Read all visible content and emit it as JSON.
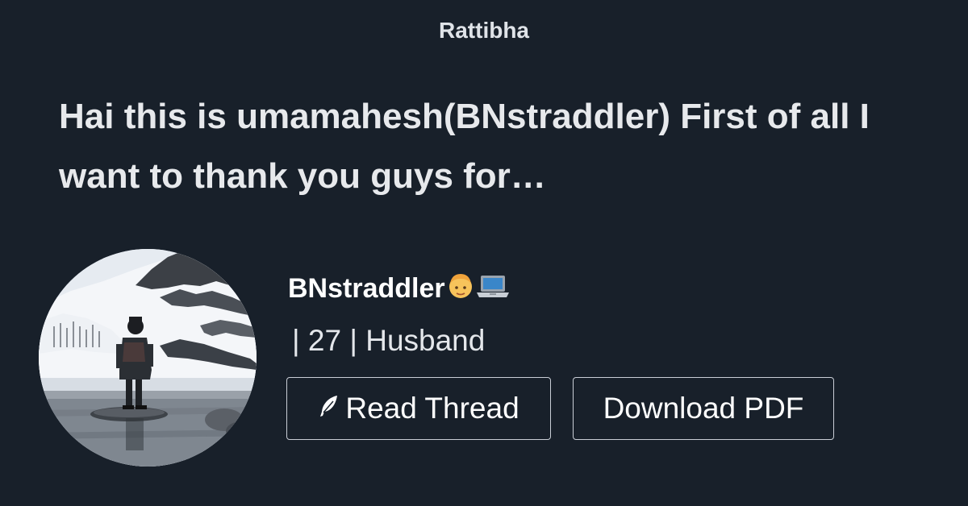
{
  "brand": "Rattibha",
  "thread": {
    "headline": "Hai this is umamahesh(BNstraddler) First of all I want to thank you guys for…"
  },
  "author": {
    "name": "BNstraddler",
    "emojis": [
      "person-emoji",
      "laptop-emoji"
    ],
    "bio": "| 27 | Husband"
  },
  "actions": {
    "read_label": "Read Thread",
    "read_icon": "feather-icon",
    "pdf_label": "Download PDF"
  },
  "colors": {
    "background": "#18202a",
    "text": "#e9ebee",
    "button_border": "#c9ced6"
  }
}
